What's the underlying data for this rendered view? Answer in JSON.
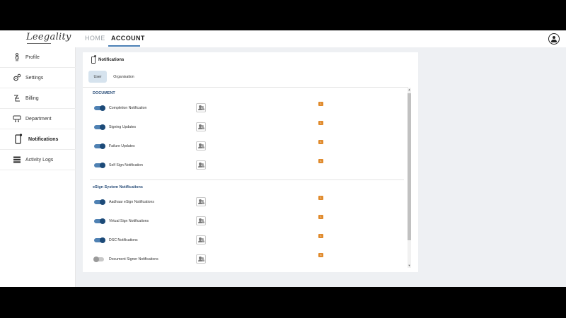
{
  "header": {
    "logo_text": "Leegality",
    "tabs": [
      {
        "label": "HOME"
      },
      {
        "label": "ACCOUNT"
      }
    ],
    "user_icon": "account-circle-icon"
  },
  "sidebar": {
    "items": [
      {
        "label": "Profile",
        "icon": "person-icon"
      },
      {
        "label": "Settings",
        "icon": "gears-icon"
      },
      {
        "label": "Billing",
        "icon": "billing-icon"
      },
      {
        "label": "Department",
        "icon": "department-icon"
      },
      {
        "label": "Notifications",
        "icon": "phone-notification-icon"
      },
      {
        "label": "Activity Logs",
        "icon": "logs-icon"
      }
    ]
  },
  "notifications": {
    "title": "Notifications",
    "tabs": [
      {
        "label": "User"
      },
      {
        "label": "Organisation"
      }
    ],
    "sections": [
      {
        "heading": "DOCUMENT",
        "rows": [
          {
            "label": "Completion Notification",
            "enabled": true,
            "badge": "1"
          },
          {
            "label": "Signing Updates",
            "enabled": true,
            "badge": "1"
          },
          {
            "label": "Failure Updates",
            "enabled": true,
            "badge": "1"
          },
          {
            "label": "Self Sign Notification",
            "enabled": true,
            "badge": "1"
          }
        ]
      },
      {
        "heading": "eSign System Notifications",
        "rows": [
          {
            "label": "Aadhaar eSign Notifications",
            "enabled": true,
            "badge": "1"
          },
          {
            "label": "Virtual Sign Notifications",
            "enabled": true,
            "badge": "1"
          },
          {
            "label": "DSC Notifications",
            "enabled": true,
            "badge": "1"
          },
          {
            "label": "Document Signer Notifications",
            "enabled": false,
            "badge": "4"
          }
        ]
      }
    ]
  },
  "colors": {
    "accent": "#4a7fb5",
    "toggle_on": "#1c4a78",
    "badge": "#e08a2c",
    "section_heading": "#2b4f7a"
  }
}
